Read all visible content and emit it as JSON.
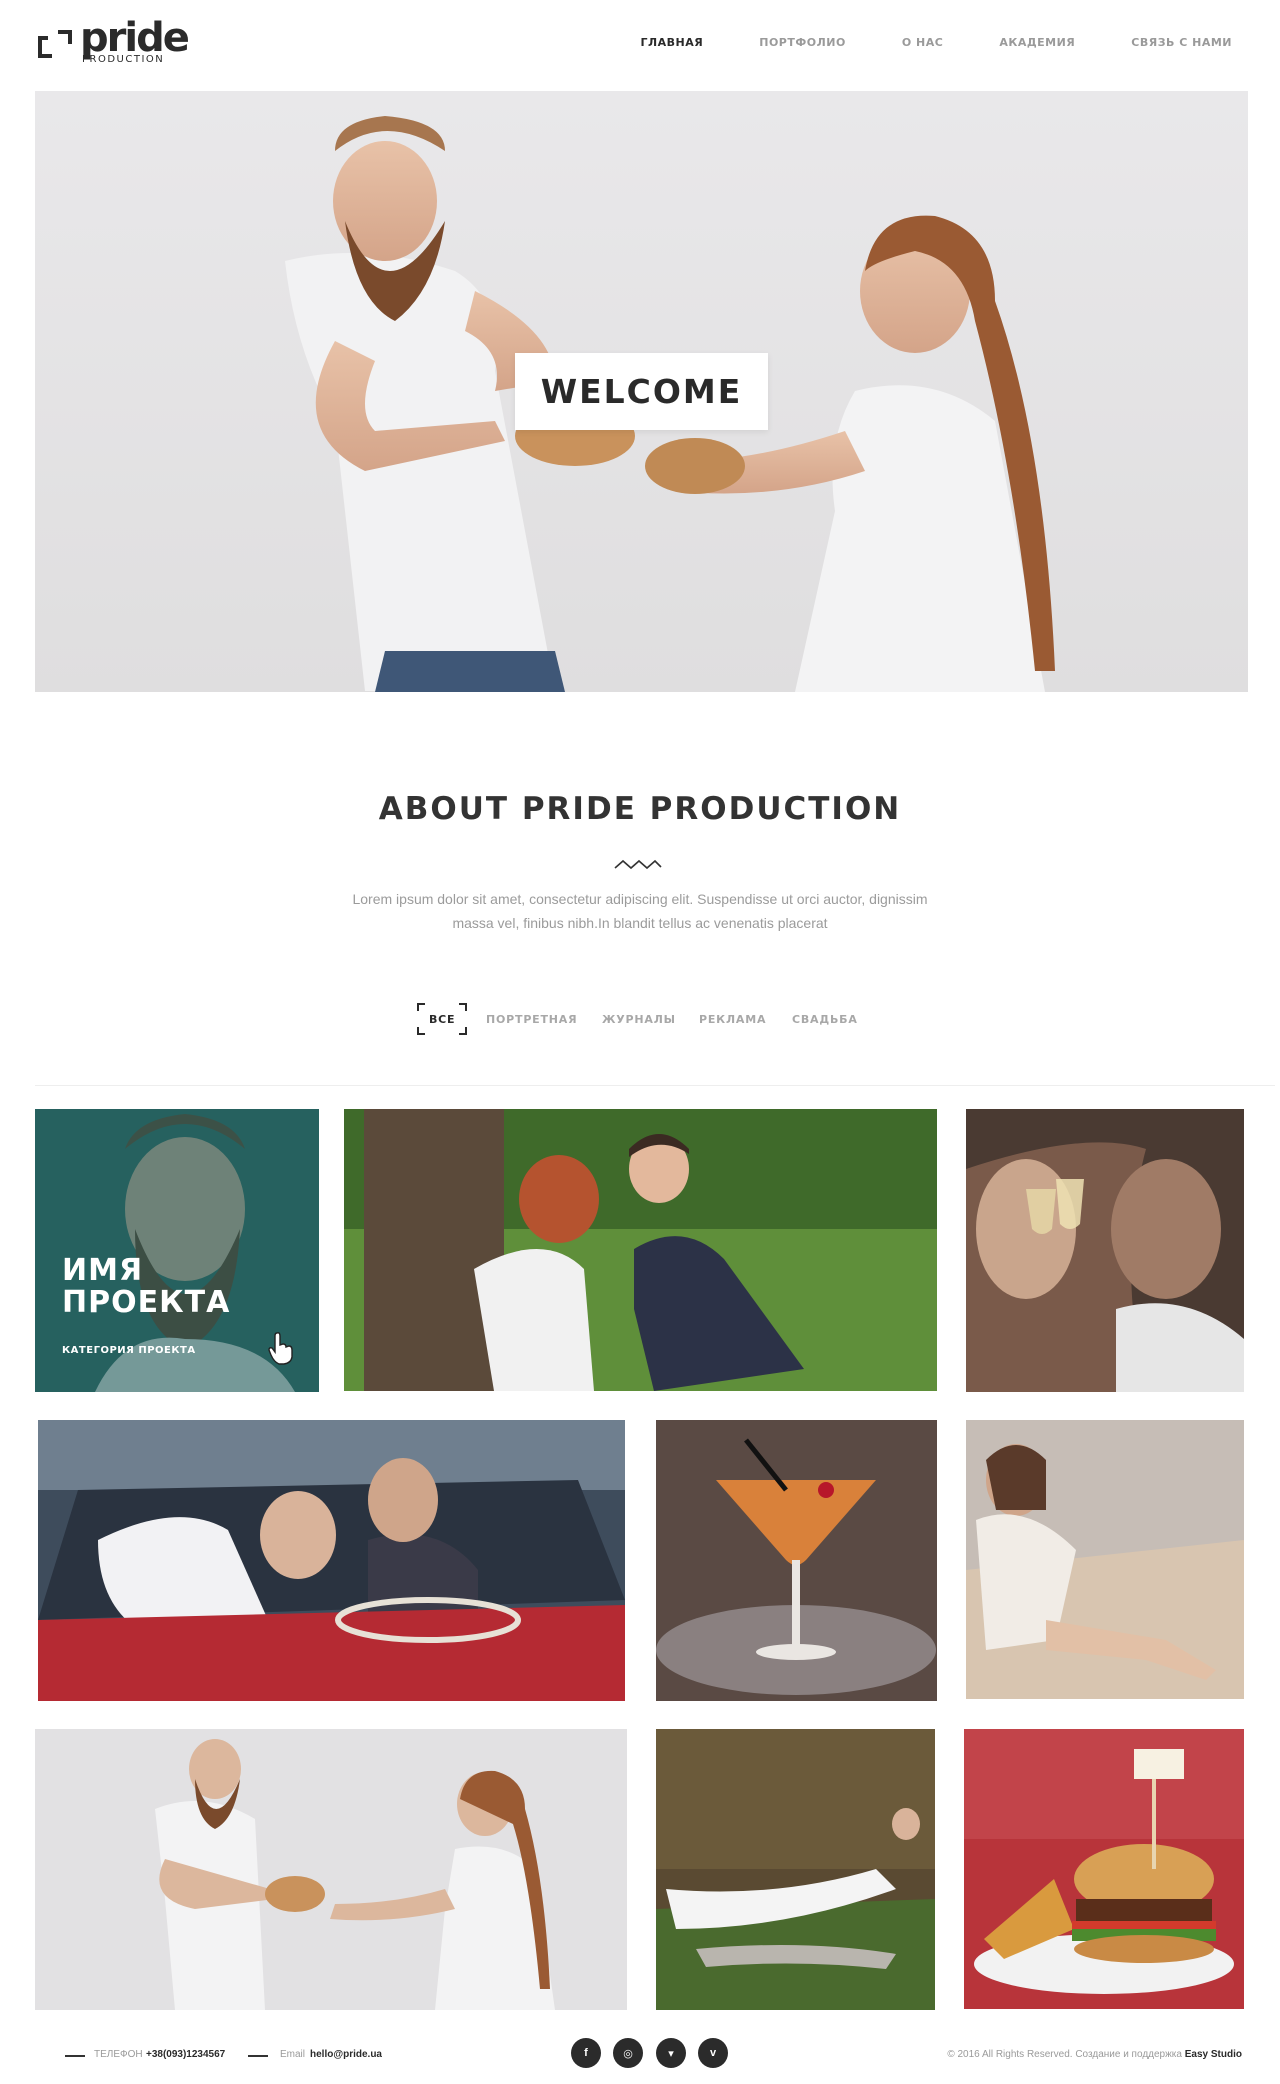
{
  "brand": {
    "logo_word": "pride",
    "logo_sub": "PRODUCTION"
  },
  "nav": {
    "items": [
      {
        "label": "ГЛАВНАЯ",
        "active": true
      },
      {
        "label": "ПОРТФОЛИО",
        "active": false
      },
      {
        "label": "О НАС",
        "active": false
      },
      {
        "label": "АКАДЕМИЯ",
        "active": false
      },
      {
        "label": "СВЯЗЬ С НАМИ",
        "active": false
      }
    ]
  },
  "hero": {
    "welcome": "WELCOME"
  },
  "about": {
    "title": "ABOUT PRIDE PRODUCTION",
    "text": "Lorem ipsum dolor sit amet, consectetur adipiscing elit. Suspendisse ut orci auctor, dignissim massa vel, finibus nibh.In blandit tellus ac venenatis placerat"
  },
  "filters": {
    "items": [
      "ВСЕ",
      "ПОРТРЕТНАЯ",
      "ЖУРНАЛЫ",
      "РЕКЛАМА",
      "СВАДЬБА"
    ],
    "active": "ВСЕ"
  },
  "portfolio": {
    "hover_title": "ИМЯ\nПРОЕКТА",
    "hover_category": "КАТЕГОРИЯ ПРОЕКТА",
    "tiles": [
      {
        "subject": "bearded man portrait"
      },
      {
        "subject": "couple with ice cream in park"
      },
      {
        "subject": "couple with wine glasses"
      },
      {
        "subject": "bride and groom in vintage car"
      },
      {
        "subject": "cocktail glass with smoke"
      },
      {
        "subject": "woman sitting on floor"
      },
      {
        "subject": "man and woman fighting over bread"
      },
      {
        "subject": "woman lying on lounge outdoors"
      },
      {
        "subject": "burger with fries"
      }
    ]
  },
  "footer": {
    "phone_label": "ТЕЛЕФОН",
    "phone": "+38(093)1234567",
    "email_label": "Email",
    "email": "hello@pride.ua",
    "social": [
      {
        "name": "facebook-icon",
        "glyph": "f"
      },
      {
        "name": "dribbble-icon",
        "glyph": "◎"
      },
      {
        "name": "twitter-icon",
        "glyph": "▾"
      },
      {
        "name": "vimeo-icon",
        "glyph": "v"
      }
    ],
    "copyright": "© 2016 All Rights Reserved. Создание и поддержка",
    "studio": "Easy Studio"
  },
  "colors": {
    "accent_overlay": "#155856",
    "text_dark": "#2a2a2a",
    "text_muted": "#9b9b9b"
  }
}
